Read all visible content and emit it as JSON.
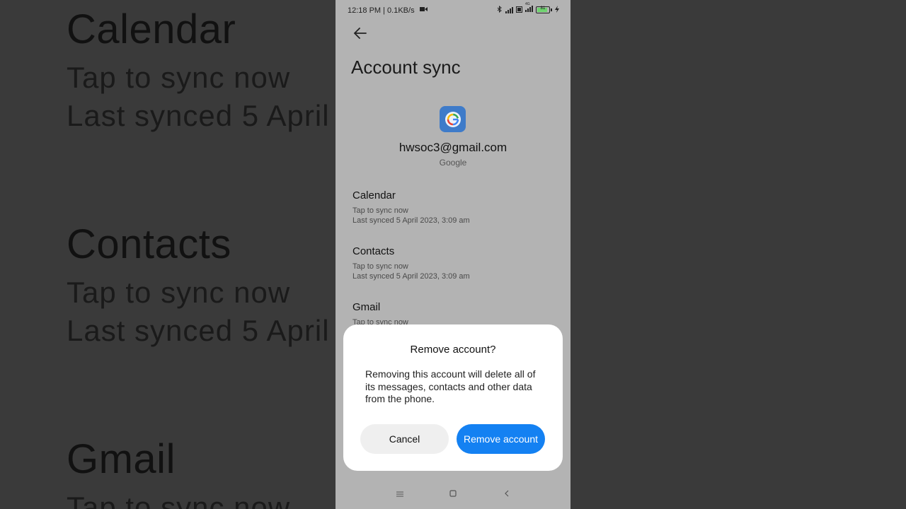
{
  "status_bar": {
    "time_speed": "12:18 PM | 0.1KB/s",
    "network_label": "4G",
    "battery_level": "81"
  },
  "header": {
    "title": "Account sync"
  },
  "account": {
    "email": "hwsoc3@gmail.com",
    "provider": "Google"
  },
  "sync_items": [
    {
      "name": "Calendar",
      "action": "Tap to sync now",
      "last_synced": "Last synced 5 April 2023, 3:09 am"
    },
    {
      "name": "Contacts",
      "action": "Tap to sync now",
      "last_synced": "Last synced 5 April 2023, 3:09 am"
    },
    {
      "name": "Gmail",
      "action": "Tap to sync now"
    }
  ],
  "background_zoom": {
    "items": [
      {
        "name": "Calendar",
        "action": "Tap to sync now",
        "last_synced": "Last synced 5 April"
      },
      {
        "name": "Contacts",
        "action": "Tap to sync now",
        "last_synced": "Last synced 5 April"
      },
      {
        "name": "Gmail",
        "action": "Tap to sync now"
      }
    ]
  },
  "dialog": {
    "title": "Remove account?",
    "message": "Removing this account will delete all of its messages, contacts and other data from the phone.",
    "cancel_label": "Cancel",
    "confirm_label": "Remove account"
  },
  "colors": {
    "primary_button": "#1481f2",
    "account_icon_bg": "#3e7bc9"
  }
}
